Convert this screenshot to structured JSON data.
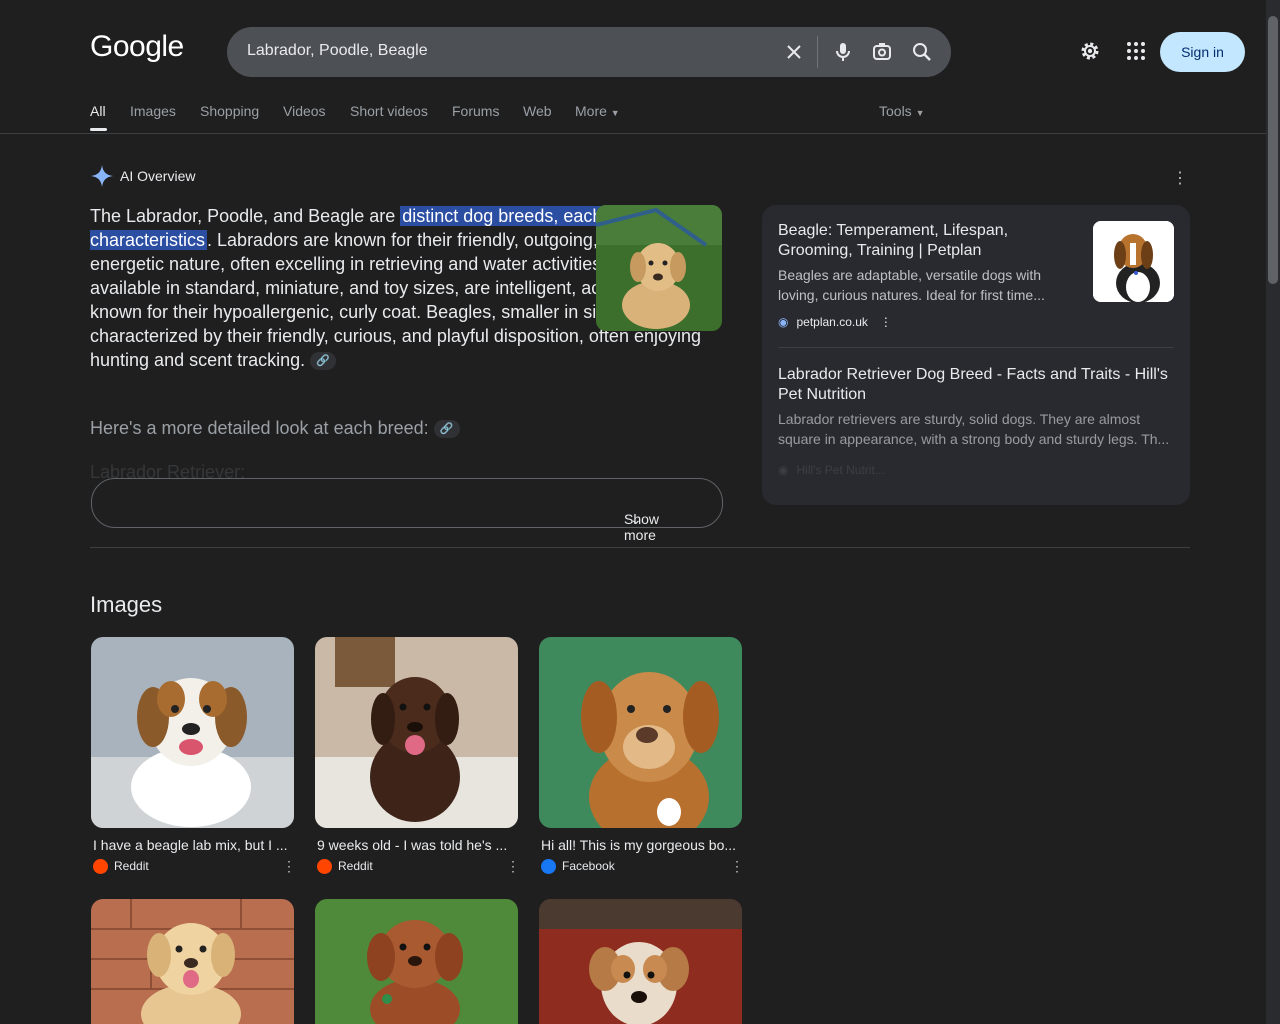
{
  "logo": "Google",
  "search": {
    "query": "Labrador, Poodle, Beagle"
  },
  "header": {
    "signin_label": "Sign in"
  },
  "tabs": [
    "All",
    "Images",
    "Shopping",
    "Videos",
    "Short videos",
    "Forums",
    "Web",
    "More"
  ],
  "tools_label": "Tools",
  "ai_overview": {
    "title": "AI Overview",
    "text_before": "The Labrador, Poodle, and Beagle are ",
    "highlight": "distinct dog breeds, each with unique characteristics",
    "text_after": ". Labradors are known for their friendly, outgoing, and energetic nature, often excelling in retrieving and water activities. Poodles, available in standard, miniature, and toy sizes, are intelligent, active, and known for their hypoallergenic, curly coat. Beagles, smaller in size, are characterized by their friendly, curious, and playful disposition, often enjoying hunting and scent tracking.",
    "subheading": "Here's a more detailed look at each breed:",
    "faded_heading": "Labrador Retriever:",
    "show_more": "Show more"
  },
  "sources": [
    {
      "title": "Beagle: Temperament, Lifespan, Grooming, Training | Petplan",
      "desc": "Beagles are adaptable, versatile dogs with loving, curious natures. Ideal for first time...",
      "site": "petplan.co.uk"
    },
    {
      "title": "Labrador Retriever Dog Breed - Facts and Traits - Hill's Pet Nutrition",
      "desc": "Labrador retrievers are sturdy, solid dogs. They are almost square in appearance, with a strong body and sturdy legs. Th...",
      "site": "Hill's Pet Nutrit..."
    }
  ],
  "images_section": {
    "heading": "Images",
    "items": [
      {
        "caption": "I have a beagle lab mix, but I ...",
        "source": "Reddit"
      },
      {
        "caption": "9 weeks old - I was told he's ...",
        "source": "Reddit"
      },
      {
        "caption": "Hi all! This is my gorgeous bo...",
        "source": "Facebook"
      }
    ]
  },
  "colors": {
    "background": "#1f1f1f",
    "accent": "#c2e7ff",
    "highlight": "#2b4ea3"
  }
}
